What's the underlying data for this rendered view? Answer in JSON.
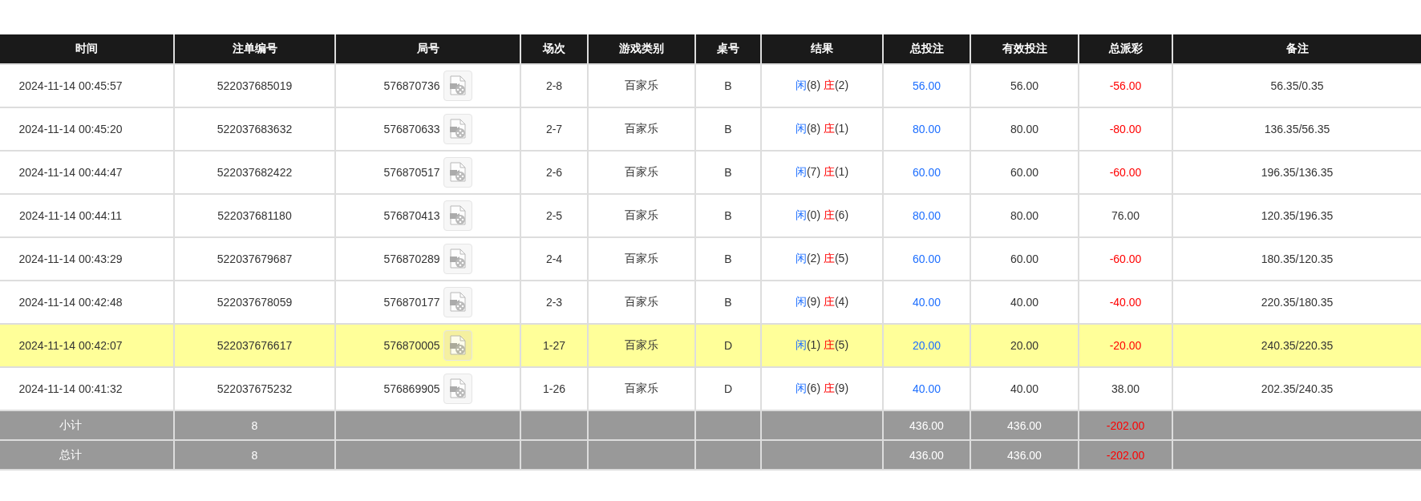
{
  "table": {
    "columns": [
      "时间",
      "注单编号",
      "局号",
      "场次",
      "游戏类别",
      "桌号",
      "结果",
      "总投注",
      "有效投注",
      "总派彩",
      "备注"
    ],
    "rows": [
      {
        "selected": false,
        "time": "2024-11-14 00:45:57",
        "bet_no": "522037685019",
        "round_no": "576870736",
        "session": "2-8",
        "game": "百家乐",
        "table": "B",
        "result": {
          "player_label": "闲",
          "player": "(8)",
          "banker_label": "庄",
          "banker": "(2)"
        },
        "total_bet": "56.00",
        "valid_bet": "56.00",
        "payout": {
          "text": "-56.00",
          "color": "#ff0000"
        },
        "note": "56.35/0.35"
      },
      {
        "selected": false,
        "time": "2024-11-14 00:45:20",
        "bet_no": "522037683632",
        "round_no": "576870633",
        "session": "2-7",
        "game": "百家乐",
        "table": "B",
        "result": {
          "player_label": "闲",
          "player": "(8)",
          "banker_label": "庄",
          "banker": "(1)"
        },
        "total_bet": "80.00",
        "valid_bet": "80.00",
        "payout": {
          "text": "-80.00",
          "color": "#ff0000"
        },
        "note": "136.35/56.35"
      },
      {
        "selected": false,
        "time": "2024-11-14 00:44:47",
        "bet_no": "522037682422",
        "round_no": "576870517",
        "session": "2-6",
        "game": "百家乐",
        "table": "B",
        "result": {
          "player_label": "闲",
          "player": "(7)",
          "banker_label": "庄",
          "banker": "(1)"
        },
        "total_bet": "60.00",
        "valid_bet": "60.00",
        "payout": {
          "text": "-60.00",
          "color": "#ff0000"
        },
        "note": "196.35/136.35"
      },
      {
        "selected": false,
        "time": "2024-11-14 00:44:11",
        "bet_no": "522037681180",
        "round_no": "576870413",
        "session": "2-5",
        "game": "百家乐",
        "table": "B",
        "result": {
          "player_label": "闲",
          "player": "(0)",
          "banker_label": "庄",
          "banker": "(6)"
        },
        "total_bet": "80.00",
        "valid_bet": "80.00",
        "payout": {
          "text": "76.00",
          "color": "#333333"
        },
        "note": "120.35/196.35"
      },
      {
        "selected": false,
        "time": "2024-11-14 00:43:29",
        "bet_no": "522037679687",
        "round_no": "576870289",
        "session": "2-4",
        "game": "百家乐",
        "table": "B",
        "result": {
          "player_label": "闲",
          "player": "(2)",
          "banker_label": "庄",
          "banker": "(5)"
        },
        "total_bet": "60.00",
        "valid_bet": "60.00",
        "payout": {
          "text": "-60.00",
          "color": "#ff0000"
        },
        "note": "180.35/120.35"
      },
      {
        "selected": false,
        "time": "2024-11-14 00:42:48",
        "bet_no": "522037678059",
        "round_no": "576870177",
        "session": "2-3",
        "game": "百家乐",
        "table": "B",
        "result": {
          "player_label": "闲",
          "player": "(9)",
          "banker_label": "庄",
          "banker": "(4)"
        },
        "total_bet": "40.00",
        "valid_bet": "40.00",
        "payout": {
          "text": "-40.00",
          "color": "#ff0000"
        },
        "note": "220.35/180.35"
      },
      {
        "selected": true,
        "time": "2024-11-14 00:42:07",
        "bet_no": "522037676617",
        "round_no": "576870005",
        "session": "1-27",
        "game": "百家乐",
        "table": "D",
        "result": {
          "player_label": "闲",
          "player": "(1)",
          "banker_label": "庄",
          "banker": "(5)"
        },
        "total_bet": "20.00",
        "valid_bet": "20.00",
        "payout": {
          "text": "-20.00",
          "color": "#ff0000"
        },
        "note": "240.35/220.35"
      },
      {
        "selected": false,
        "time": "2024-11-14 00:41:32",
        "bet_no": "522037675232",
        "round_no": "576869905",
        "session": "1-26",
        "game": "百家乐",
        "table": "D",
        "result": {
          "player_label": "闲",
          "player": "(6)",
          "banker_label": "庄",
          "banker": "(9)"
        },
        "total_bet": "40.00",
        "valid_bet": "40.00",
        "payout": {
          "text": "38.00",
          "color": "#333333"
        },
        "note": "202.35/240.35"
      }
    ],
    "summary": [
      {
        "label": "小计",
        "count": "8",
        "total_bet": "436.00",
        "valid_bet": "436.00",
        "payout": {
          "text": "-202.00",
          "color": "#ff0000"
        }
      },
      {
        "label": "总计",
        "count": "8",
        "total_bet": "436.00",
        "valid_bet": "436.00",
        "payout": {
          "text": "-202.00",
          "color": "#ff0000"
        }
      }
    ]
  }
}
